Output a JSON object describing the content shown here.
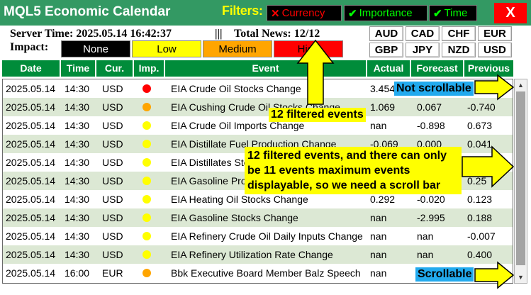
{
  "window": {
    "title": "MQL5 Economic Calendar",
    "filters_label": "Filters:",
    "filters": [
      {
        "label": "Currency",
        "mark": "✕",
        "state": "off",
        "color": "#ff0000"
      },
      {
        "label": "Importance",
        "mark": "✔",
        "state": "on",
        "color": "#00ff00"
      },
      {
        "label": "Time",
        "mark": "✔",
        "state": "on",
        "color": "#00ff00"
      }
    ],
    "close_label": "X"
  },
  "info": {
    "server_time": "Server Time: 2025.05.14 16:42:37",
    "separator": "|||",
    "total_news": "Total News: 12/12"
  },
  "impact": {
    "label": "Impact:",
    "levels": [
      {
        "label": "None",
        "color": "#000000"
      },
      {
        "label": "Low",
        "color": "#ffff00"
      },
      {
        "label": "Medium",
        "color": "#ffa500"
      },
      {
        "label": "High",
        "color": "#ff0000"
      }
    ]
  },
  "currencies": [
    "AUD",
    "CAD",
    "CHF",
    "EUR",
    "GBP",
    "JPY",
    "NZD",
    "USD"
  ],
  "table": {
    "headers": [
      "Date",
      "Time",
      "Cur.",
      "Imp.",
      "Event",
      "Actual",
      "Forecast",
      "Previous"
    ],
    "rows": [
      {
        "date": "2025.05.14",
        "time": "14:30",
        "cur": "USD",
        "imp": "high",
        "event": "EIA Crude Oil Stocks Change",
        "actual": "3.454",
        "forecast": "",
        "previous": ""
      },
      {
        "date": "2025.05.14",
        "time": "14:30",
        "cur": "USD",
        "imp": "medium",
        "event": "EIA Cushing Crude Oil Stocks Change",
        "actual": "1.069",
        "forecast": "0.067",
        "previous": "-0.740"
      },
      {
        "date": "2025.05.14",
        "time": "14:30",
        "cur": "USD",
        "imp": "low",
        "event": "EIA Crude Oil Imports Change",
        "actual": "nan",
        "forecast": "-0.898",
        "previous": "0.673"
      },
      {
        "date": "2025.05.14",
        "time": "14:30",
        "cur": "USD",
        "imp": "low",
        "event": "EIA Distillate Fuel Production Change",
        "actual": "-0.069",
        "forecast": "0.000",
        "previous": "0.041"
      },
      {
        "date": "2025.05.14",
        "time": "14:30",
        "cur": "USD",
        "imp": "low",
        "event": "EIA Distillates Stocks Change",
        "actual": "",
        "forecast": "",
        "previous": ""
      },
      {
        "date": "2025.05.14",
        "time": "14:30",
        "cur": "USD",
        "imp": "low",
        "event": "EIA Gasoline Production Change",
        "actual": "",
        "forecast": "",
        "previous": "0.25"
      },
      {
        "date": "2025.05.14",
        "time": "14:30",
        "cur": "USD",
        "imp": "low",
        "event": "EIA Heating Oil Stocks Change",
        "actual": "0.292",
        "forecast": "-0.020",
        "previous": "0.123"
      },
      {
        "date": "2025.05.14",
        "time": "14:30",
        "cur": "USD",
        "imp": "low",
        "event": "EIA Gasoline Stocks Change",
        "actual": "nan",
        "forecast": "-2.995",
        "previous": "0.188"
      },
      {
        "date": "2025.05.14",
        "time": "14:30",
        "cur": "USD",
        "imp": "low",
        "event": "EIA Refinery Crude Oil Daily Inputs Change",
        "actual": "nan",
        "forecast": "nan",
        "previous": "-0.007"
      },
      {
        "date": "2025.05.14",
        "time": "14:30",
        "cur": "USD",
        "imp": "low",
        "event": "EIA Refinery Utilization Rate Change",
        "actual": "nan",
        "forecast": "nan",
        "previous": "0.400"
      },
      {
        "date": "2025.05.14",
        "time": "16:00",
        "cur": "EUR",
        "imp": "medium",
        "event": "Bbk Executive Board Member Balz Speech",
        "actual": "nan",
        "forecast": "",
        "previous": ""
      }
    ]
  },
  "impact_colors": {
    "high": "#ff0000",
    "medium": "#ffa500",
    "low": "#ffff00"
  },
  "annotations": {
    "not_scrollable": "Not scrollable",
    "filtered_events": "12 filtered events",
    "explanation": "12 filtered events, and there can only be 11 events maximum events displayable, so we need a scroll bar",
    "scrollable": "Scrollable"
  },
  "scrollbar": {
    "up_icon": "▲",
    "down_icon": "▼"
  }
}
